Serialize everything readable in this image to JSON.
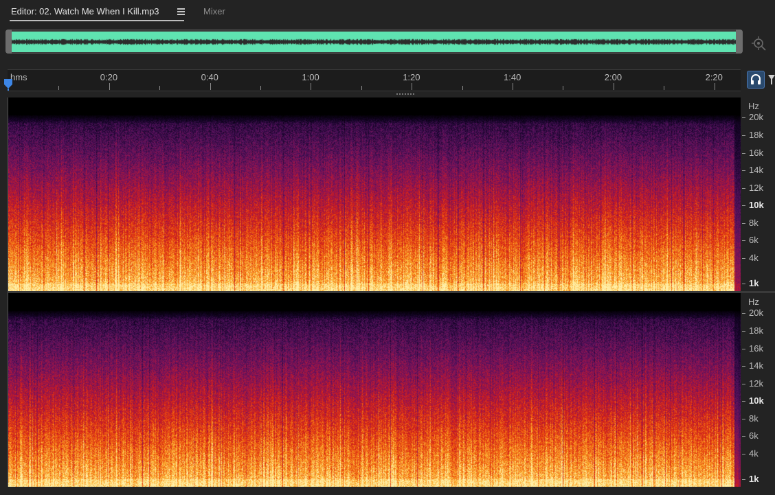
{
  "tabs": {
    "editor": "Editor: 02. Watch Me When I Kill.mp3",
    "mixer": "Mixer"
  },
  "overview": {
    "wave_color": "#5fe3b1"
  },
  "ruler": {
    "unit": "hms",
    "ticks": [
      {
        "label": "0:20",
        "seconds": 20
      },
      {
        "label": "0:40",
        "seconds": 40
      },
      {
        "label": "1:00",
        "seconds": 60
      },
      {
        "label": "1:20",
        "seconds": 80
      },
      {
        "label": "1:40",
        "seconds": 100
      },
      {
        "label": "2:00",
        "seconds": 120
      },
      {
        "label": "2:20",
        "seconds": 140
      }
    ],
    "playhead_color": "#3d86e6"
  },
  "frequency_scale": {
    "unit": "Hz",
    "labels": [
      "20k",
      "18k",
      "16k",
      "14k",
      "12k",
      "10k",
      "8k",
      "6k",
      "4k",
      "1k"
    ],
    "emphasized": [
      "10k",
      "1k"
    ]
  },
  "channels": [
    "channel-1",
    "channel-2"
  ]
}
